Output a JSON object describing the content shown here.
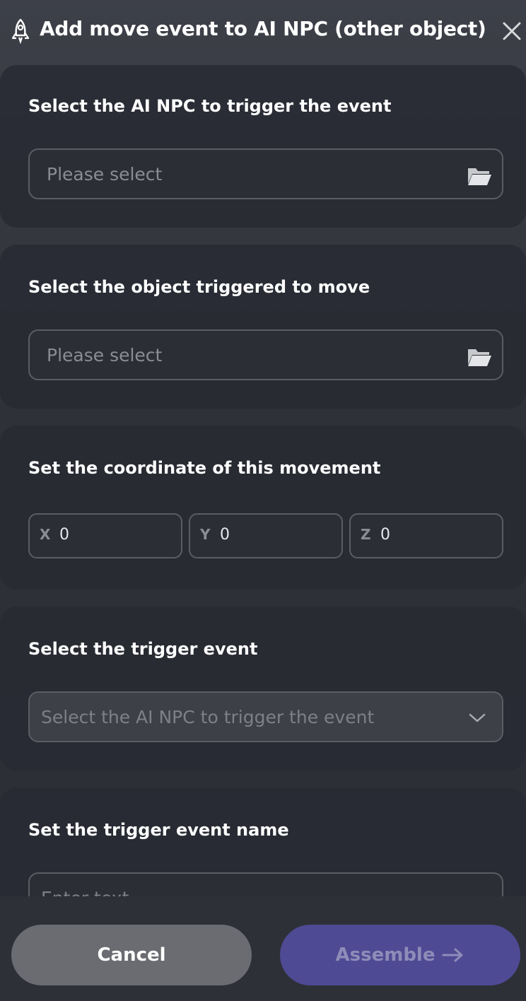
{
  "header": {
    "title": "Add move event to AI NPC (other object)",
    "icon": "rocket-icon",
    "close_icon": "close-icon"
  },
  "sections": {
    "npc": {
      "label": "Select the AI NPC to trigger the event",
      "placeholder": "Please select",
      "icon": "folder-icon"
    },
    "object": {
      "label": "Select the object triggered to move",
      "placeholder": "Please select",
      "icon": "folder-icon"
    },
    "coordinate": {
      "label": "Set the coordinate of this movement",
      "x_label": "X",
      "x_value": "0",
      "y_label": "Y",
      "y_value": "0",
      "z_label": "Z",
      "z_value": "0"
    },
    "trigger_event": {
      "label": "Select the trigger event",
      "placeholder": "Select the AI NPC to trigger the event",
      "icon": "chevron-down-icon"
    },
    "event_name": {
      "label": "Set the trigger event name",
      "placeholder": "Enter text"
    }
  },
  "footer": {
    "cancel_label": "Cancel",
    "assemble_label": "Assemble",
    "assemble_icon": "arrow-right-icon"
  },
  "colors": {
    "accent": "#4e4a94",
    "cancel": "#6b6c71",
    "background": "#2c2e35"
  }
}
